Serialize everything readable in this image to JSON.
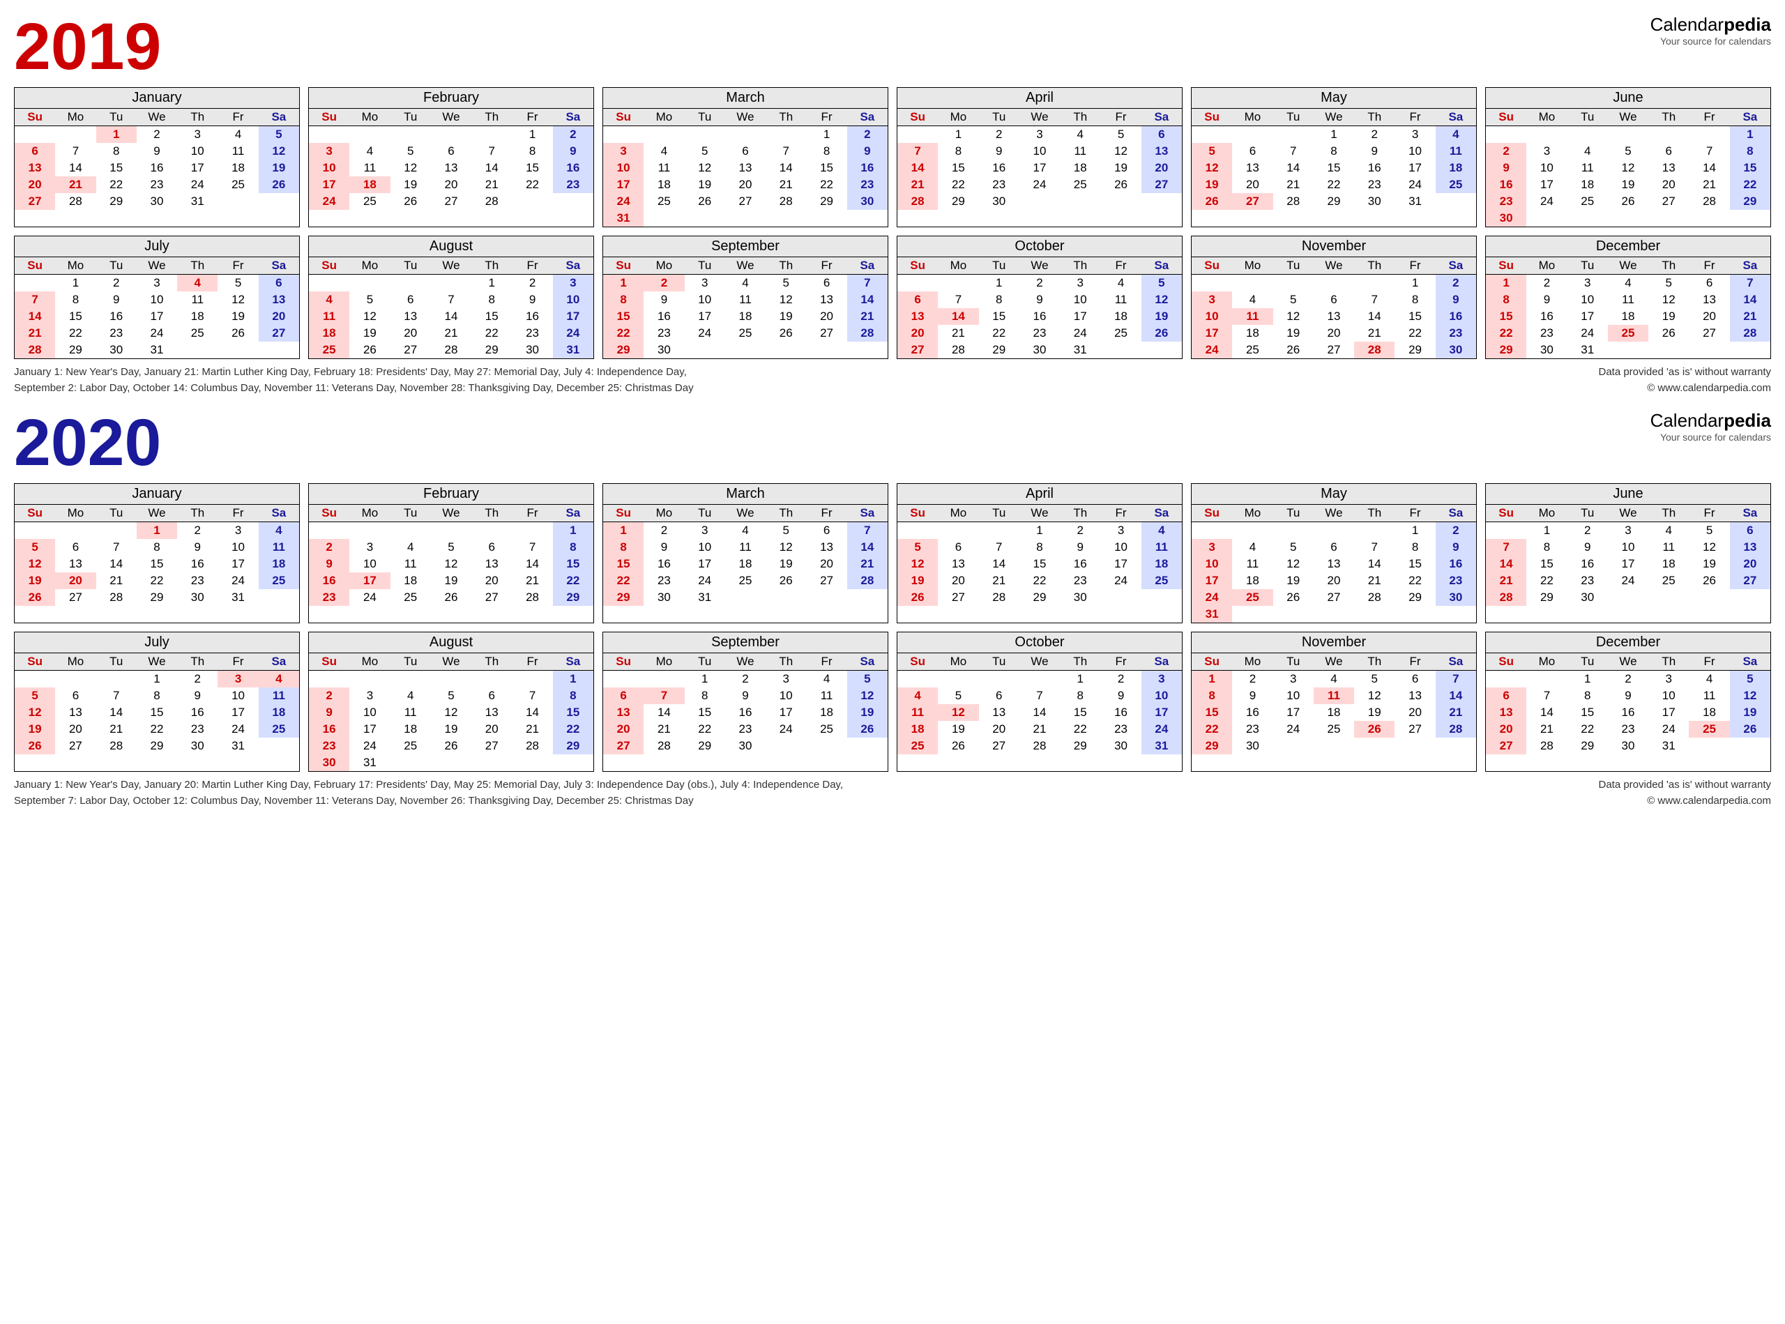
{
  "brand": {
    "name_a": "Calendar",
    "name_b": "pedia",
    "tag": "Your source for calendars"
  },
  "warranty": "Data provided 'as is' without warranty",
  "copyright": "© www.calendarpedia.com",
  "weekdays": [
    "Su",
    "Mo",
    "Tu",
    "We",
    "Th",
    "Fr",
    "Sa"
  ],
  "month_names": [
    "January",
    "February",
    "March",
    "April",
    "May",
    "June",
    "July",
    "August",
    "September",
    "October",
    "November",
    "December"
  ],
  "years": [
    {
      "year": "2019",
      "class": "y2019",
      "holidays_text": "January 1: New Year's Day, January 21: Martin Luther King Day, February 18: Presidents' Day, May 27: Memorial Day, July 4: Independence Day,\nSeptember 2: Labor Day, October 14: Columbus Day, November 11: Veterans Day, November 28: Thanksgiving Day, December 25: Christmas Day",
      "months": [
        {
          "start": 2,
          "len": 31,
          "hol": [
            1,
            21
          ]
        },
        {
          "start": 5,
          "len": 28,
          "hol": [
            18
          ]
        },
        {
          "start": 5,
          "len": 31,
          "hol": []
        },
        {
          "start": 1,
          "len": 30,
          "hol": []
        },
        {
          "start": 3,
          "len": 31,
          "hol": [
            27
          ]
        },
        {
          "start": 6,
          "len": 30,
          "hol": []
        },
        {
          "start": 1,
          "len": 31,
          "hol": [
            4
          ]
        },
        {
          "start": 4,
          "len": 31,
          "hol": []
        },
        {
          "start": 0,
          "len": 30,
          "hol": [
            2
          ]
        },
        {
          "start": 2,
          "len": 31,
          "hol": [
            14
          ]
        },
        {
          "start": 5,
          "len": 30,
          "hol": [
            11,
            28
          ]
        },
        {
          "start": 0,
          "len": 31,
          "hol": [
            25
          ]
        }
      ]
    },
    {
      "year": "2020",
      "class": "y2020",
      "holidays_text": "January 1: New Year's Day, January 20: Martin Luther King Day, February 17: Presidents' Day, May 25: Memorial Day, July 3: Independence Day (obs.), July 4: Independence Day,\nSeptember 7: Labor Day, October 12: Columbus Day, November 11: Veterans Day, November 26: Thanksgiving Day, December 25: Christmas Day",
      "months": [
        {
          "start": 3,
          "len": 31,
          "hol": [
            1,
            20
          ]
        },
        {
          "start": 6,
          "len": 29,
          "hol": [
            17
          ]
        },
        {
          "start": 0,
          "len": 31,
          "hol": []
        },
        {
          "start": 3,
          "len": 30,
          "hol": []
        },
        {
          "start": 5,
          "len": 31,
          "hol": [
            25
          ]
        },
        {
          "start": 1,
          "len": 30,
          "hol": []
        },
        {
          "start": 3,
          "len": 31,
          "hol": [
            3,
            4
          ]
        },
        {
          "start": 6,
          "len": 31,
          "hol": []
        },
        {
          "start": 2,
          "len": 30,
          "hol": [
            7
          ]
        },
        {
          "start": 4,
          "len": 31,
          "hol": [
            12
          ]
        },
        {
          "start": 0,
          "len": 30,
          "hol": [
            11,
            26
          ]
        },
        {
          "start": 2,
          "len": 31,
          "hol": [
            25
          ]
        }
      ]
    }
  ]
}
